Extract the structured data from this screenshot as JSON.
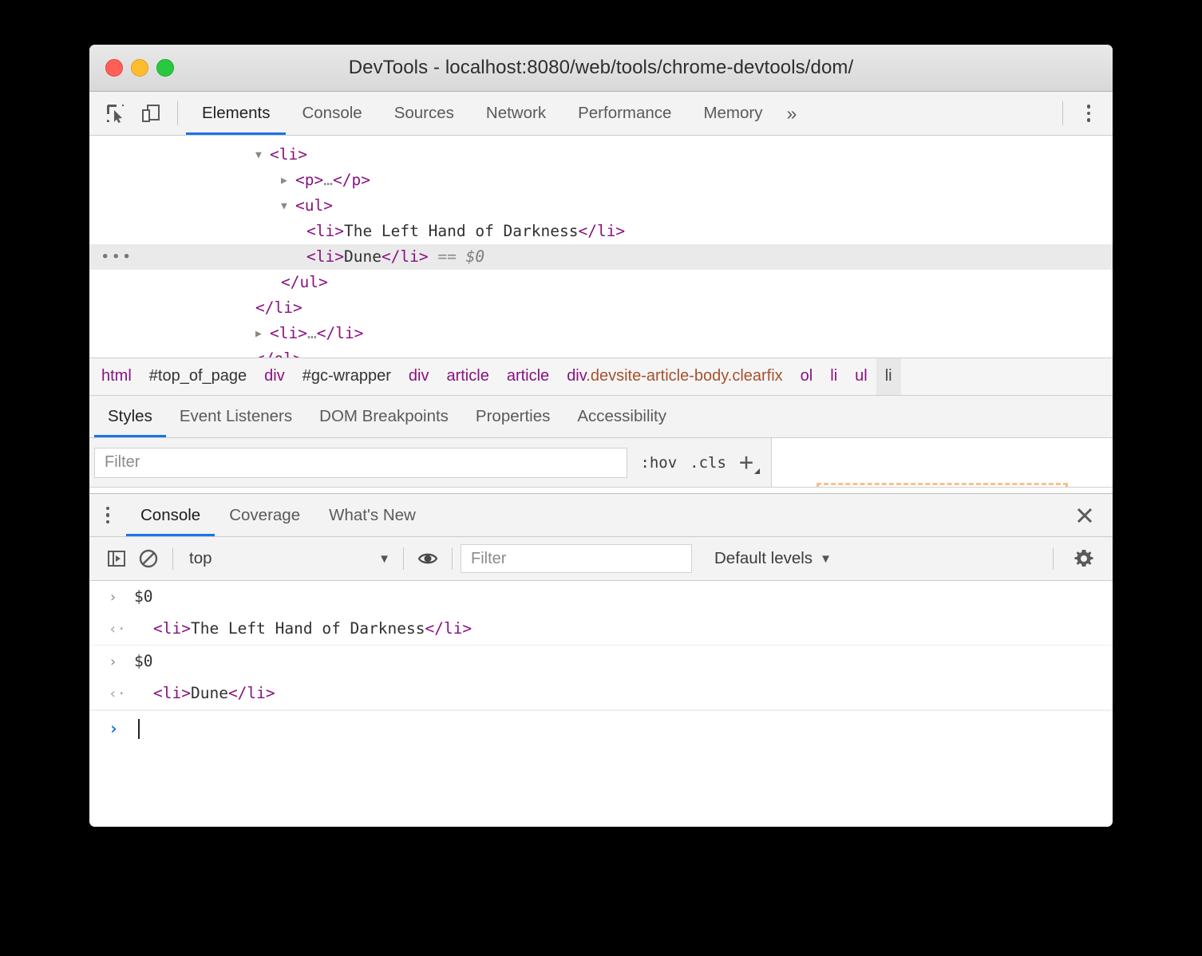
{
  "window": {
    "title": "DevTools - localhost:8080/web/tools/chrome-devtools/dom/",
    "traffic_lights": [
      "close",
      "minimize",
      "maximize"
    ]
  },
  "main_toolbar": {
    "icons": [
      "inspect-element-icon",
      "device-toolbar-icon"
    ],
    "tabs": [
      {
        "label": "Elements",
        "selected": true
      },
      {
        "label": "Console",
        "selected": false
      },
      {
        "label": "Sources",
        "selected": false
      },
      {
        "label": "Network",
        "selected": false
      },
      {
        "label": "Performance",
        "selected": false
      },
      {
        "label": "Memory",
        "selected": false
      }
    ],
    "overflow_label": "»",
    "more_options": "kebab-menu-icon"
  },
  "dom_tree": {
    "rows": [
      {
        "indent": 1,
        "twisty": "▼",
        "segments": [
          {
            "t": "tag",
            "v": "<li>"
          }
        ],
        "selected": false
      },
      {
        "indent": 2,
        "twisty": "▶",
        "segments": [
          {
            "t": "tag",
            "v": "<p>"
          },
          {
            "t": "meta",
            "v": "…"
          },
          {
            "t": "tag",
            "v": "</p>"
          }
        ],
        "selected": false
      },
      {
        "indent": 2,
        "twisty": "▼",
        "segments": [
          {
            "t": "tag",
            "v": "<ul>"
          }
        ],
        "selected": false
      },
      {
        "indent": 3,
        "twisty": "",
        "segments": [
          {
            "t": "tag",
            "v": "<li>"
          },
          {
            "t": "txt",
            "v": "The Left Hand of Darkness"
          },
          {
            "t": "tag",
            "v": "</li>"
          }
        ],
        "selected": false
      },
      {
        "indent": 3,
        "twisty": "",
        "segments": [
          {
            "t": "tag",
            "v": "<li>"
          },
          {
            "t": "txt",
            "v": "Dune"
          },
          {
            "t": "tag",
            "v": "</li>"
          },
          {
            "t": "meta",
            "v": " == "
          },
          {
            "t": "dvar",
            "v": "$0"
          }
        ],
        "selected": true,
        "marker": "•••"
      },
      {
        "indent": 2,
        "twisty": "",
        "segments": [
          {
            "t": "tag",
            "v": "</ul>"
          }
        ],
        "selected": false
      },
      {
        "indent": 1,
        "twisty": "",
        "segments": [
          {
            "t": "tag",
            "v": "</li>"
          }
        ],
        "selected": false
      },
      {
        "indent": 1,
        "twisty": "▶",
        "segments": [
          {
            "t": "tag",
            "v": "<li>"
          },
          {
            "t": "meta",
            "v": "…"
          },
          {
            "t": "tag",
            "v": "</li>"
          }
        ],
        "selected": false
      },
      {
        "indent": 1,
        "twisty": "",
        "segments": [
          {
            "t": "tag",
            "v": "</ol>"
          }
        ],
        "selected": false
      }
    ]
  },
  "breadcrumb": {
    "items": [
      {
        "label": "html",
        "kind": "tag",
        "active": false
      },
      {
        "label": "#top_of_page",
        "kind": "id",
        "active": false
      },
      {
        "label": "div",
        "kind": "tag",
        "active": false
      },
      {
        "label": "#gc-wrapper",
        "kind": "id",
        "active": false
      },
      {
        "label": "div",
        "kind": "tag",
        "active": false
      },
      {
        "label": "article",
        "kind": "tag",
        "active": false
      },
      {
        "label": "article",
        "kind": "tag",
        "active": false
      },
      {
        "label": "div",
        "kind": "cls",
        "classes": ".devsite-article-body.clearfix",
        "active": false
      },
      {
        "label": "ol",
        "kind": "tag",
        "active": false
      },
      {
        "label": "li",
        "kind": "tag",
        "active": false
      },
      {
        "label": "ul",
        "kind": "tag",
        "active": false
      },
      {
        "label": "li",
        "kind": "tag",
        "active": true
      }
    ]
  },
  "styles_pane": {
    "tabs": [
      {
        "label": "Styles",
        "selected": true
      },
      {
        "label": "Event Listeners",
        "selected": false
      },
      {
        "label": "DOM Breakpoints",
        "selected": false
      },
      {
        "label": "Properties",
        "selected": false
      },
      {
        "label": "Accessibility",
        "selected": false
      }
    ],
    "filter_placeholder": "Filter",
    "hov_label": ":hov",
    "cls_label": ".cls",
    "new_rule_label": "+",
    "box_model_border_color": "#f4c28c"
  },
  "drawer": {
    "kebab": "drawer-menu-icon",
    "tabs": [
      {
        "label": "Console",
        "selected": true
      },
      {
        "label": "Coverage",
        "selected": false
      },
      {
        "label": "What's New",
        "selected": false
      }
    ],
    "close_label": "✕"
  },
  "console_toolbar": {
    "sidebar_toggle": "console-sidebar-icon",
    "clear_label": "clear-console-icon",
    "context": "top",
    "context_caret": "▼",
    "eye_icon": "live-expression-eye-icon",
    "filter_placeholder": "Filter",
    "levels_label": "Default levels",
    "levels_caret": "▼",
    "settings_icon": "settings-gear-icon"
  },
  "console_log": {
    "entries": [
      {
        "type": "input",
        "glyph": "›",
        "segments": [
          {
            "t": "txt",
            "v": "$0"
          }
        ]
      },
      {
        "type": "result",
        "glyph": "‹·",
        "segments": [
          {
            "t": "tag",
            "v": "<li>"
          },
          {
            "t": "txt",
            "v": "The Left Hand of Darkness"
          },
          {
            "t": "tag",
            "v": "</li>"
          }
        ]
      },
      {
        "type": "input",
        "glyph": "›",
        "segments": [
          {
            "t": "txt",
            "v": "$0"
          }
        ]
      },
      {
        "type": "result",
        "glyph": "‹·",
        "segments": [
          {
            "t": "tag",
            "v": "<li>"
          },
          {
            "t": "txt",
            "v": "Dune"
          },
          {
            "t": "tag",
            "v": "</li>"
          }
        ]
      }
    ],
    "prompt": {
      "arrow": "›",
      "value": ""
    }
  },
  "colors": {
    "accent": "#1a73e8",
    "tag": "#881280",
    "class_name": "#a5522d",
    "selected_row": "#eaeaea",
    "chrome_bg": "#f3f3f3"
  }
}
